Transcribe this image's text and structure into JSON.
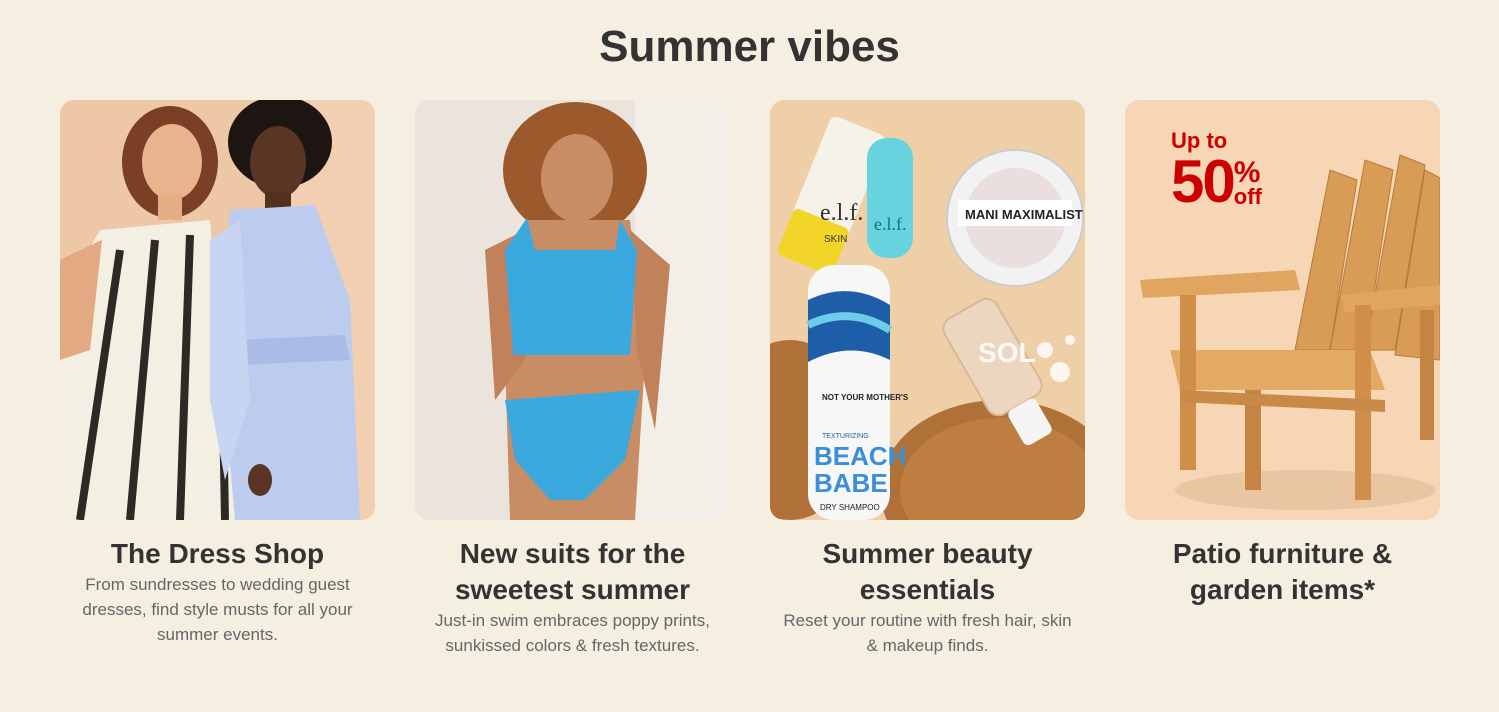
{
  "section": {
    "title": "Summer vibes"
  },
  "cards": [
    {
      "title": "The Dress Shop",
      "description": "From sundresses to wedding guest dresses, find style musts for all your summer events."
    },
    {
      "title": "New suits for the sweetest summer",
      "description": "Just-in swim embraces poppy prints, sunkissed colors & fresh textures."
    },
    {
      "title": "Summer beauty essentials",
      "description": "Reset your routine with fresh hair, skin & makeup finds.",
      "product_labels": {
        "elf1": "e.l.f.",
        "elf1_sub": "SKIN",
        "elf2": "e.l.f.",
        "mani": "MANI MAXIMALIST",
        "spray_brand": "NOT YOUR MOTHER'S",
        "spray_small": "TEXTURIZING",
        "spray_name1": "BEACH",
        "spray_name2": "BABE",
        "spray_sub": "DRY SHAMPOO",
        "sol": "SOL"
      }
    },
    {
      "title": "Patio furniture & garden items*",
      "description": "",
      "promo": {
        "up_to": "Up to",
        "percent": "50",
        "sign": "%",
        "off": "off"
      }
    }
  ],
  "colors": {
    "background": "#f5efe2",
    "promo_red": "#cc0000",
    "title_text": "#333333",
    "desc_text": "#666666"
  }
}
